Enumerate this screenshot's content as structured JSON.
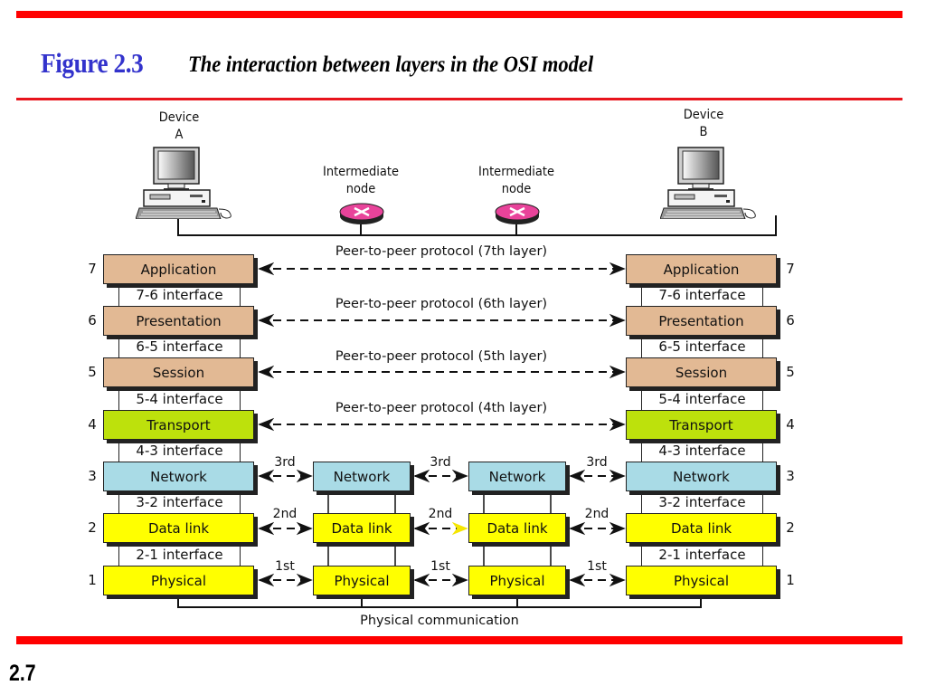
{
  "header": {
    "figure_label": "Figure 2.3",
    "caption": "The interaction between layers in the OSI model"
  },
  "footer": {
    "page_number": "2.7"
  },
  "colors": {
    "accent_red": "#ff0000",
    "figure_label_blue": "#3333cc",
    "upper_layer_fill": "#e2b994",
    "transport_fill": "#bde10c",
    "network_fill": "#a9dbe6",
    "lower_layer_fill": "#ffff00",
    "router_fill": "#e8439a"
  },
  "devices": {
    "a": {
      "label_line1": "Device",
      "label_line2": "A",
      "icon": "computer-icon"
    },
    "b": {
      "label_line1": "Device",
      "label_line2": "B",
      "icon": "computer-icon"
    }
  },
  "intermediate_nodes": [
    {
      "label_line1": "Intermediate",
      "label_line2": "node",
      "icon": "router-icon"
    },
    {
      "label_line1": "Intermediate",
      "label_line2": "node",
      "icon": "router-icon"
    }
  ],
  "layers": [
    {
      "number": "7",
      "name": "Application"
    },
    {
      "number": "6",
      "name": "Presentation"
    },
    {
      "number": "5",
      "name": "Session"
    },
    {
      "number": "4",
      "name": "Transport"
    },
    {
      "number": "3",
      "name": "Network"
    },
    {
      "number": "2",
      "name": "Data link"
    },
    {
      "number": "1",
      "name": "Physical"
    }
  ],
  "interfaces": [
    "7-6 interface",
    "6-5 interface",
    "5-4 interface",
    "4-3 interface",
    "3-2 interface",
    "2-1 interface"
  ],
  "peer_protocols": [
    "Peer-to-peer protocol (7th layer)",
    "Peer-to-peer protocol (6th layer)",
    "Peer-to-peer protocol (5th layer)",
    "Peer-to-peer protocol (4th layer)"
  ],
  "hop_labels": {
    "network": "3rd",
    "data_link": "2nd",
    "physical": "1st"
  },
  "physical_communication": "Physical communication"
}
